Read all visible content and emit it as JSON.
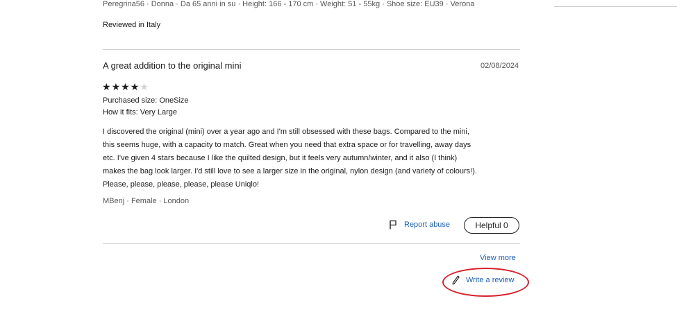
{
  "previous_review": {
    "reviewer_meta": "Peregrina56 · Donna · Da 65 anni in su · Height: 166 - 170 cm · Weight: 51 - 55kg · Shoe size: EU39 · Verona",
    "reviewed_in": "Reviewed in Italy"
  },
  "review": {
    "title": "A great addition to the original mini",
    "date": "02/08/2024",
    "rating": 4,
    "rating_max": 5,
    "purchased_size": "Purchased size: OneSize",
    "how_it_fits": "How it fits: Very Large",
    "body_lines": [
      "I discovered the original (mini) over a year ago and I'm still obsessed with these bags. Compared to the mini,",
      "this seems huge, with a capacity to match. Great when you need that extra space or for travelling, away days",
      "etc. I've given 4 stars because I like the quilted design, but it feels very autumn/winter, and it also (I think)",
      "makes the bag look larger. I'd still love to see a larger size in the original, nylon design (and variety of colours!).",
      "Please, please, please, please, please Uniqlo!"
    ],
    "reviewer_meta": "MBenj · Female · London",
    "report_label": "Report abuse",
    "helpful_label": "Helpful 0"
  },
  "footer": {
    "view_more": "View more",
    "write_review": "Write a review"
  },
  "colors": {
    "link": "#1d5fb8",
    "highlight": "#d9202a"
  },
  "icons": {
    "report": "flag-icon",
    "write": "pencil-icon"
  }
}
